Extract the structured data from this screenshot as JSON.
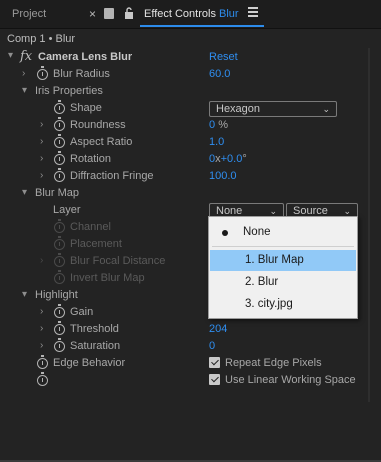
{
  "tabs": {
    "project_label": "Project",
    "close_glyph": "×",
    "effect_controls_prefix": "Effect Controls",
    "effect_controls_layer": "Blur"
  },
  "comp_title": "Comp 1 • Blur",
  "effect": {
    "fx_glyph": "fx",
    "name": "Camera Lens Blur",
    "reset_label": "Reset"
  },
  "params": {
    "blur_radius": {
      "label": "Blur Radius",
      "value": "60.0"
    },
    "iris_properties": {
      "label": "Iris Properties"
    },
    "shape": {
      "label": "Shape",
      "value": "Hexagon"
    },
    "roundness": {
      "label": "Roundness",
      "value": "0",
      "unit": "%"
    },
    "aspect_ratio": {
      "label": "Aspect Ratio",
      "value": "1.0"
    },
    "rotation": {
      "label": "Rotation",
      "value_turns": "0",
      "value_sep": "x",
      "value_deg": "+0.0",
      "unit": "°"
    },
    "diffraction_fringe": {
      "label": "Diffraction Fringe",
      "value": "100.0"
    },
    "blur_map": {
      "label": "Blur Map"
    },
    "layer": {
      "label": "Layer",
      "value": "None",
      "source_value": "Source"
    },
    "channel": {
      "label": "Channel"
    },
    "placement": {
      "label": "Placement"
    },
    "blur_focal_distance": {
      "label": "Blur Focal Distance"
    },
    "invert_blur_map": {
      "label": "Invert Blur Map"
    },
    "highlight": {
      "label": "Highlight"
    },
    "gain": {
      "label": "Gain"
    },
    "threshold": {
      "label": "Threshold",
      "value": "204"
    },
    "saturation": {
      "label": "Saturation",
      "value": "0"
    },
    "edge_behavior": {
      "label": "Edge Behavior",
      "checkbox_label": "Repeat Edge Pixels",
      "checked": true
    },
    "linear_working_space": {
      "checkbox_label": "Use Linear Working Space",
      "checked": true
    }
  },
  "popup_menu": {
    "items": [
      {
        "label": "None",
        "current": true
      },
      {
        "label": "1. Blur Map",
        "highlighted": true
      },
      {
        "label": "2. Blur"
      },
      {
        "label": "3. city.jpg"
      }
    ]
  },
  "colors": {
    "accent_blue": "#2d8ceb",
    "panel_bg": "#232323",
    "menu_highlight": "#91c9f7"
  }
}
